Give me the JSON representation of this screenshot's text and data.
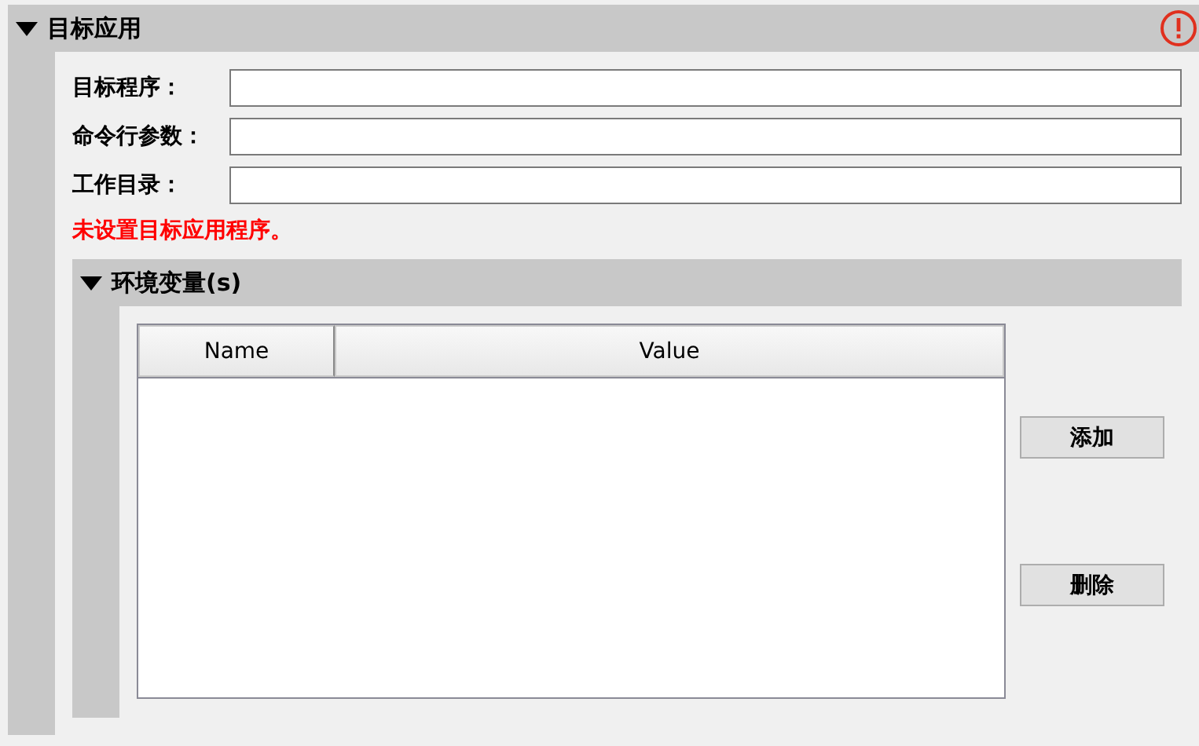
{
  "section": {
    "title": "目标应用",
    "expanded": true,
    "warning": true,
    "fields": [
      {
        "label": "目标程序："
      },
      {
        "label": "命令行参数："
      },
      {
        "label": "工作目录："
      }
    ],
    "error": "未设置目标应用程序。",
    "subsection": {
      "title": "环境变量(s)",
      "expanded": true,
      "table": {
        "columns": [
          "Name",
          "Value"
        ]
      },
      "buttons": [
        "添加",
        "删除"
      ]
    }
  }
}
